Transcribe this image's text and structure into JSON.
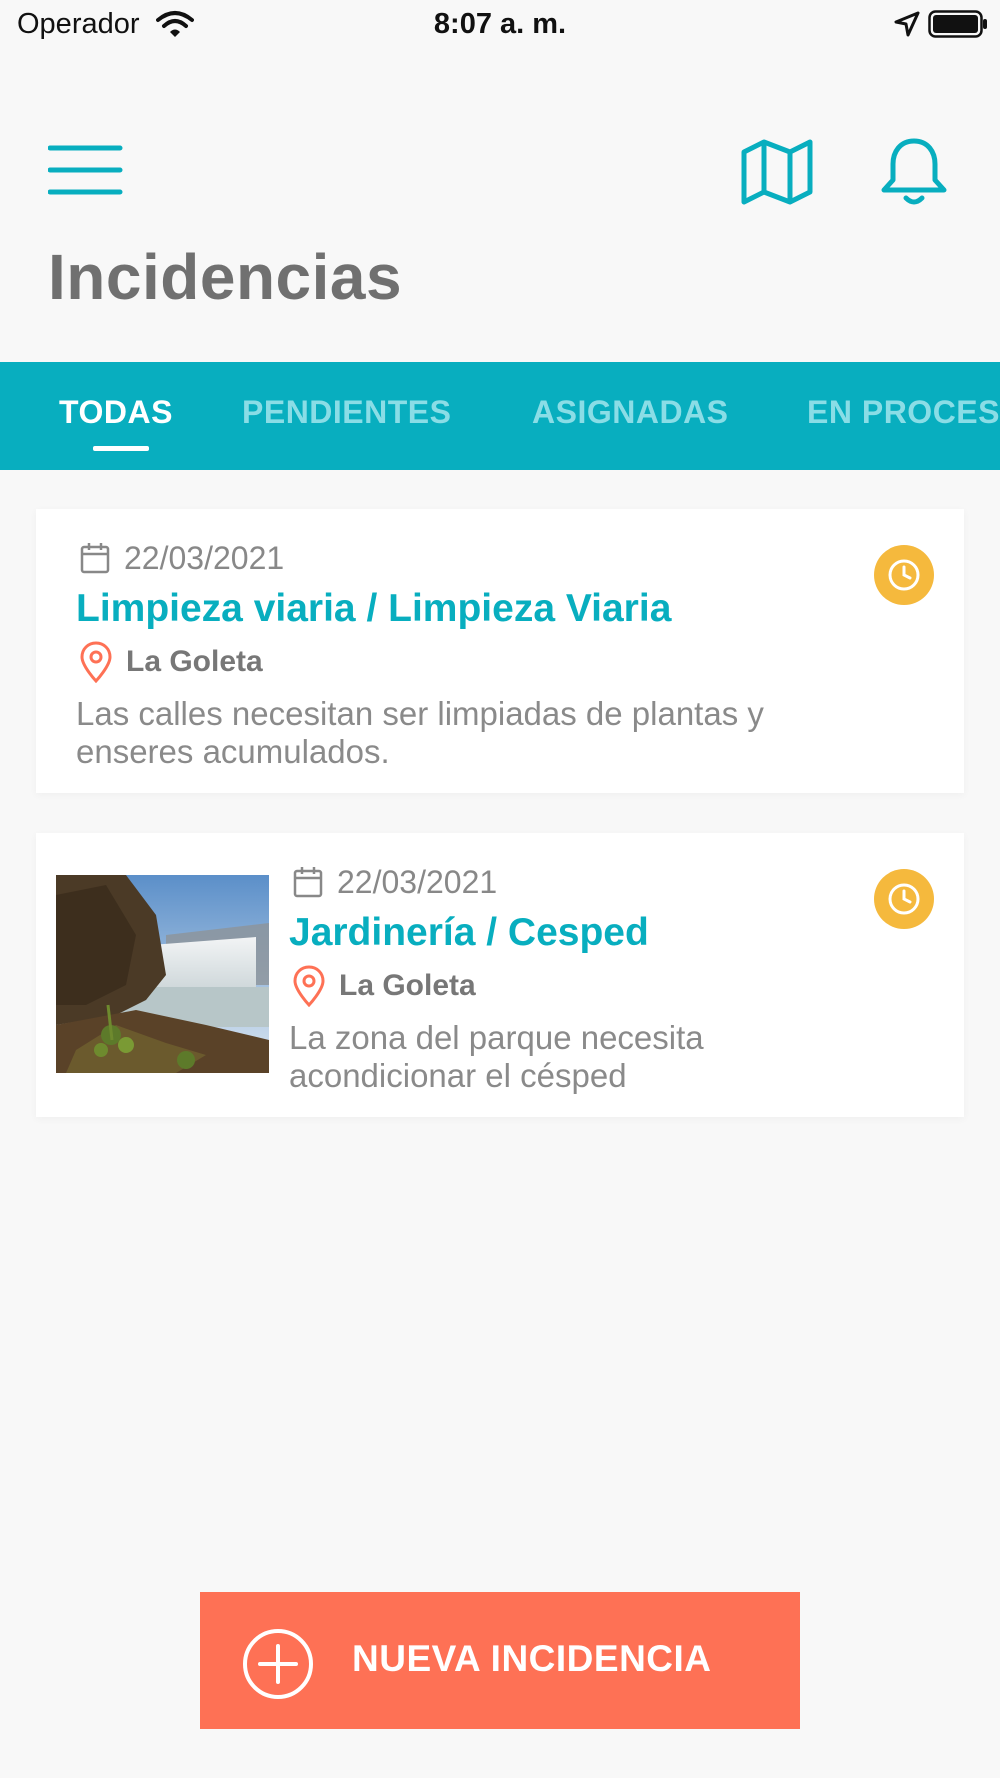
{
  "status_bar": {
    "carrier": "Operador",
    "time": "8:07 a. m."
  },
  "header": {
    "title": "Incidencias",
    "icons": [
      "menu-icon",
      "map-icon",
      "bell-icon"
    ]
  },
  "tabs": [
    {
      "label": "TODAS",
      "active": true
    },
    {
      "label": "PENDIENTES",
      "active": false
    },
    {
      "label": "ASIGNADAS",
      "active": false
    },
    {
      "label": "EN PROCESO",
      "active": false
    }
  ],
  "incidents": [
    {
      "date": "22/03/2021",
      "title": "Limpieza viaria / Limpieza Viaria",
      "location": "La Goleta",
      "description": "Las calles necesitan ser limpiadas de plantas y enseres acumulados.",
      "status_icon": "clock-icon",
      "has_image": false
    },
    {
      "date": "22/03/2021",
      "title": "Jardinería / Cesped",
      "location": "La Goleta",
      "description": "La zona del parque necesita acondicionar el césped",
      "status_icon": "clock-icon",
      "has_image": true
    }
  ],
  "new_button": {
    "label": "NUEVA INCIDENCIA",
    "icon": "plus-circle-icon"
  },
  "colors": {
    "teal": "#08aebf",
    "coral": "#fe7155",
    "status_pending": "#f5b93d",
    "title_gray": "#707070",
    "background": "#f8f8f8"
  }
}
